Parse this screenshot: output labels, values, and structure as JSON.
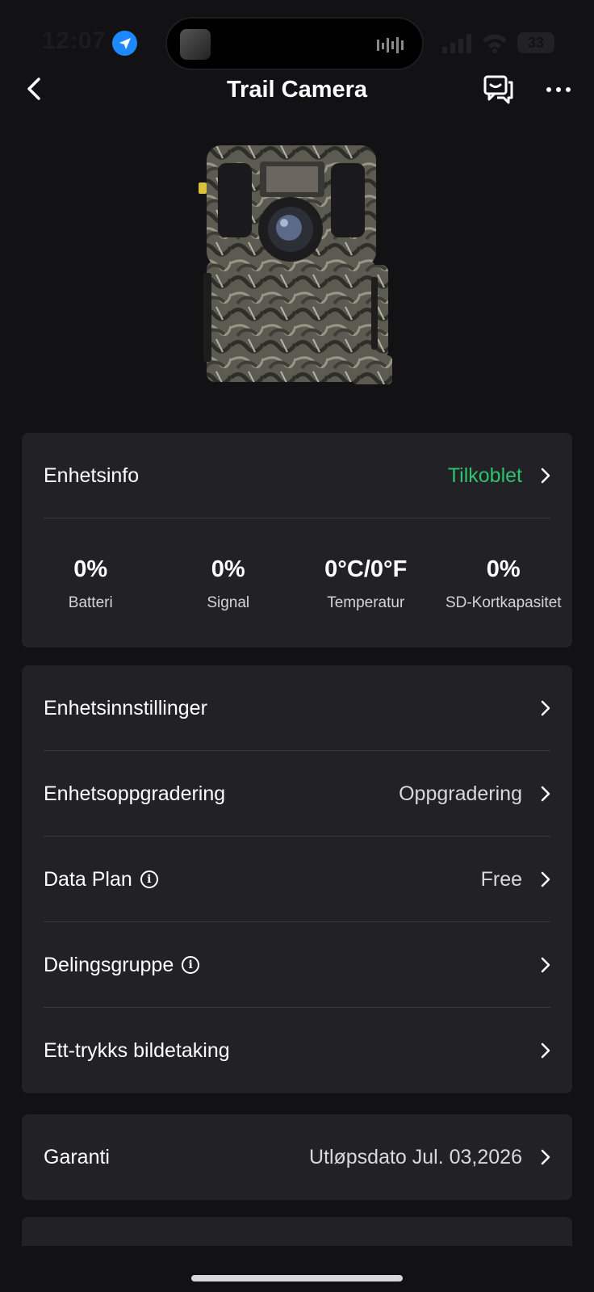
{
  "status_bar": {
    "time": "12:07",
    "battery": "33"
  },
  "nav": {
    "title": "Trail Camera"
  },
  "device_info": {
    "title": "Enhetsinfo",
    "status": "Tilkoblet",
    "status_color": "#2fc26f",
    "stats": [
      {
        "value": "0%",
        "label": "Batteri"
      },
      {
        "value": "0%",
        "label": "Signal"
      },
      {
        "value": "0°C/0°F",
        "label": "Temperatur"
      },
      {
        "value": "0%",
        "label": "SD-Kortkapasitet"
      }
    ]
  },
  "settings": {
    "items": [
      {
        "label": "Enhetsinnstillinger",
        "value": ""
      },
      {
        "label": "Enhetsoppgradering",
        "value": "Oppgradering"
      },
      {
        "label": "Data Plan",
        "value": "Free"
      },
      {
        "label": "Delingsgruppe",
        "value": ""
      },
      {
        "label": "Ett-trykks bildetaking",
        "value": ""
      }
    ]
  },
  "warranty": {
    "label": "Garanti",
    "value": "Utløpsdato Jul. 03,2026"
  }
}
